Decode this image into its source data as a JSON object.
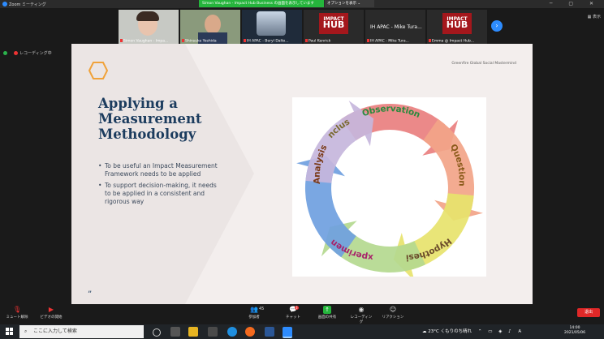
{
  "window": {
    "title": "Zoom ミーティング"
  },
  "share_banner": "Simon Vaughan - Impact Hub Business の画面を表示しています",
  "share_options": "オプションを表示 ⌄",
  "view_button": "表示",
  "participants": [
    {
      "name": "Simon Vaughan - Impa..."
    },
    {
      "name": "Shinsuke Yoshida"
    },
    {
      "name": "IH APAC - Beryl Dalto..."
    },
    {
      "name": "Paul Kenrick"
    },
    {
      "name": "IH APAC - Mike Tura..."
    },
    {
      "name": "IH APAC - Mike Tura..."
    },
    {
      "name": "Emma @ Impact Hub..."
    }
  ],
  "recording_status": "レコーディング中",
  "slide": {
    "title_lines": [
      "Applying a",
      "Measurement",
      "Methodology"
    ],
    "bullets": [
      "To be useful an Impact Measurement Framework needs to be applied",
      "To support decision-making, it needs to be applied in a consistent and rigorous way"
    ],
    "credit": "Greenfire Global Social Mastermind",
    "quote_mark": "”",
    "cycle_steps": [
      "Observation",
      "Question",
      "Hypothesis",
      "Experiment",
      "Analysis",
      "Conclusion"
    ],
    "cycle_colors": [
      "#e97f7f",
      "#f2a488",
      "#e7e36d",
      "#b4d98f",
      "#6fa0e0",
      "#c6b6dc"
    ],
    "cycle_text_colors": [
      "#2b8a3e",
      "#8a5a1a",
      "#6a4a2a",
      "#a8226a",
      "#7a3a18",
      "#7a6a30"
    ]
  },
  "toolbar": {
    "mute": "ミュート解除",
    "video": "ビデオの開始",
    "participants": "参加者",
    "participants_count": "45",
    "chat": "チャット",
    "chat_badge": "3",
    "share": "画面の共有",
    "record": "レコーディング",
    "reactions": "リアクション",
    "end": "退出"
  },
  "taskbar": {
    "search_placeholder": "ここに入力して検索",
    "weather": "23°C  くもりのち晴れ",
    "time": "14:00",
    "date": "2021/05/06",
    "lang": "A"
  }
}
